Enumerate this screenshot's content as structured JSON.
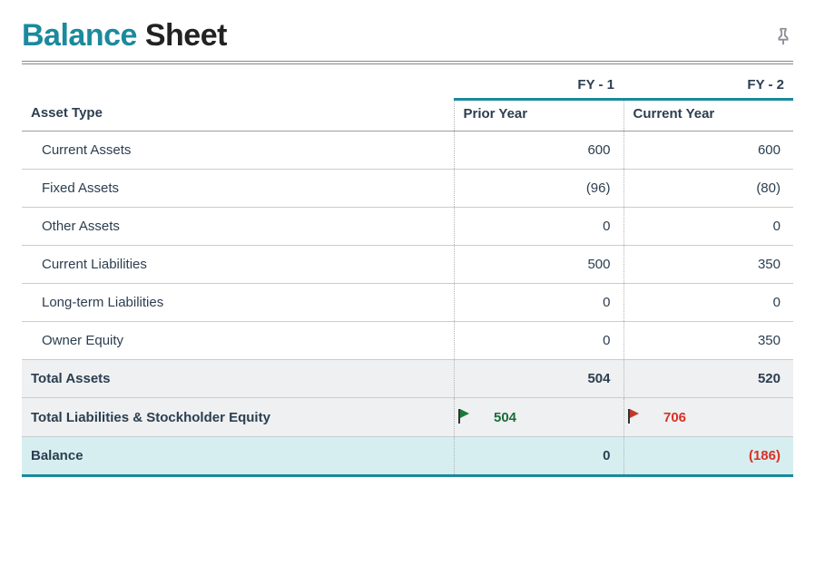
{
  "title": {
    "accent": "Balance",
    "plain": "Sheet"
  },
  "columns": {
    "asset_type": "Asset Type",
    "fy1": "FY - 1",
    "fy2": "FY - 2",
    "prior": "Prior Year",
    "current": "Current Year"
  },
  "rows": [
    {
      "label": "Current Assets",
      "prior": "600",
      "current": "600",
      "prior_neg": false,
      "current_neg": false
    },
    {
      "label": "Fixed Assets",
      "prior": "(96)",
      "current": "(80)",
      "prior_neg": true,
      "current_neg": true
    },
    {
      "label": "Other Assets",
      "prior": "0",
      "current": "0",
      "prior_neg": false,
      "current_neg": false
    },
    {
      "label": "Current Liabilities",
      "prior": "500",
      "current": "350",
      "prior_neg": false,
      "current_neg": false
    },
    {
      "label": "Long-term Liabilities",
      "prior": "0",
      "current": "0",
      "prior_neg": false,
      "current_neg": false
    },
    {
      "label": "Owner Equity",
      "prior": "0",
      "current": "350",
      "prior_neg": false,
      "current_neg": false
    }
  ],
  "totals": {
    "total_assets": {
      "label": "Total Assets",
      "prior": "504",
      "current": "520"
    },
    "tlse": {
      "label": "Total Liabilities & Stockholder Equity",
      "prior": "504",
      "current": "706",
      "prior_flag": "green",
      "current_flag": "red"
    },
    "balance": {
      "label": "Balance",
      "prior": "0",
      "current": "(186)",
      "current_neg": true
    }
  }
}
